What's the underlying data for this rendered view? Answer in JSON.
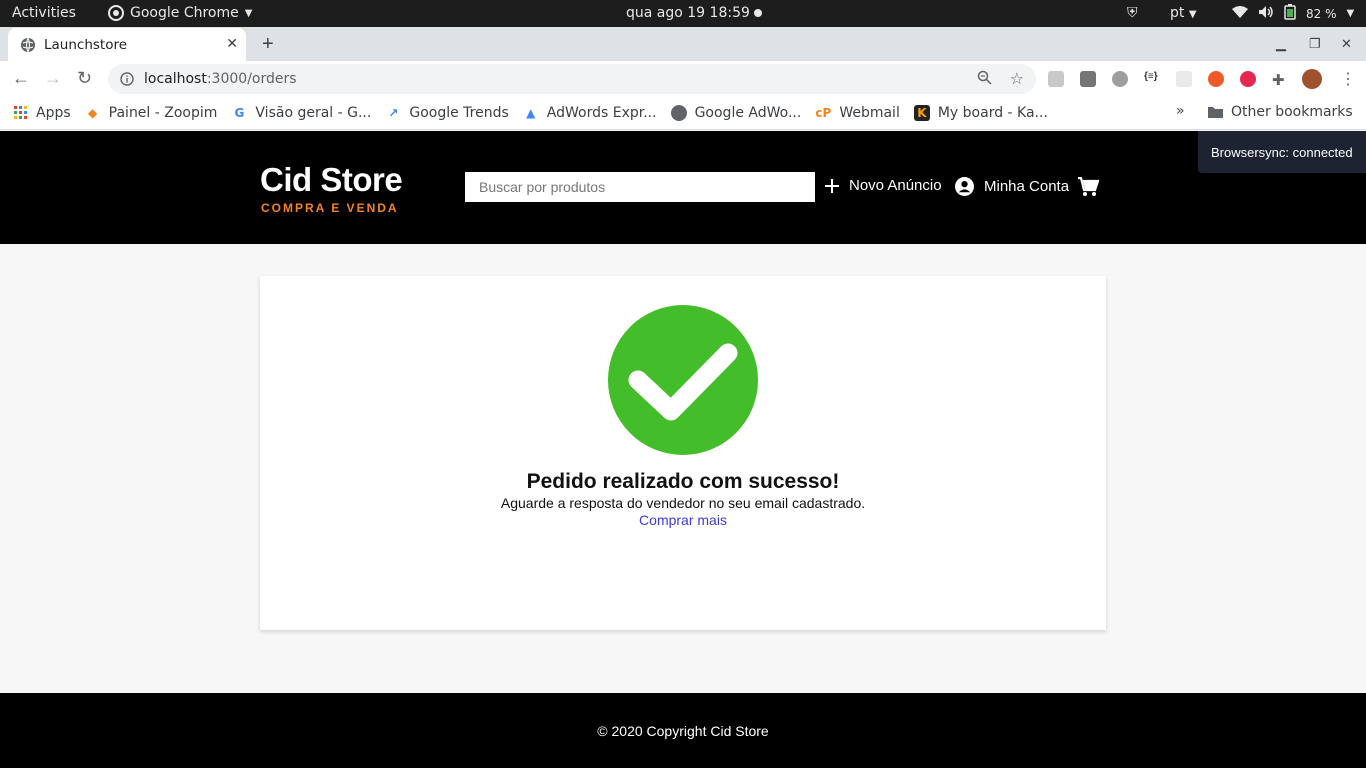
{
  "os": {
    "activities": "Activities",
    "app_name": "Google Chrome",
    "clock": "qua ago 19  18:59",
    "lang": "pt",
    "battery": "82 %"
  },
  "browser": {
    "tab_title": "Launchstore",
    "url_host": "localhost",
    "url_path": ":3000/orders",
    "bookmarks": [
      "Apps",
      "Painel - Zoopim",
      "Visão geral - G...",
      "Google Trends",
      "AdWords Expr...",
      "Google AdWo...",
      "Webmail",
      "My board - Ka..."
    ],
    "bookmarks_more": "»",
    "other_bookmarks": "Other bookmarks"
  },
  "site": {
    "logo": "Cid Store",
    "tagline": "COMPRA E VENDA",
    "search_placeholder": "Buscar por produtos",
    "new_ad": "Novo Anúncio",
    "account": "Minha Conta",
    "browsersync": "Browsersync: connected"
  },
  "success": {
    "title": "Pedido realizado com sucesso!",
    "subtitle": "Aguarde a resposta do vendedor no seu email cadastrado.",
    "link": "Comprar mais",
    "color": "#44bd2b"
  },
  "footer": {
    "text": "© 2020 Copyright Cid Store"
  }
}
